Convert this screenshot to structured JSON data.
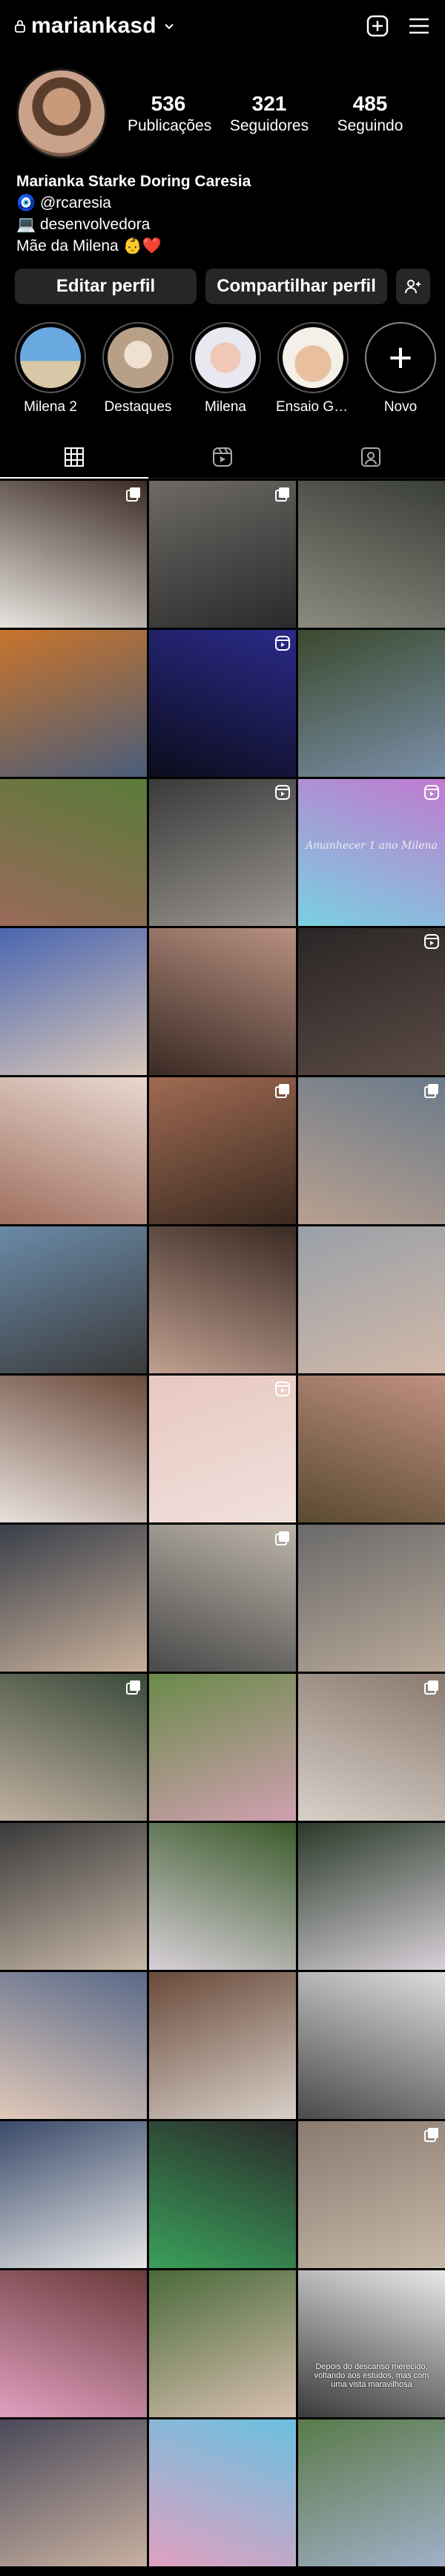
{
  "header": {
    "username": "mariankasd",
    "icons": [
      "lock-icon",
      "chevron-down-icon",
      "create-icon",
      "menu-icon"
    ]
  },
  "stats": [
    {
      "count": "536",
      "label": "Publicações"
    },
    {
      "count": "321",
      "label": "Seguidores"
    },
    {
      "count": "485",
      "label": "Seguindo"
    }
  ],
  "bio": {
    "name": "Marianka Starke Doring Caresia",
    "line1": "🧿 @rcaresia",
    "line2": "💻 desenvolvedora",
    "line3": "Mãe da Milena 👶❤️"
  },
  "actions": {
    "edit": "Editar perfil",
    "share": "Compartilhar perfil"
  },
  "highlights": [
    {
      "label": "Milena 2",
      "color": "#3d7fb8"
    },
    {
      "label": "Destaques",
      "color": "#c8b6a0"
    },
    {
      "label": "Milena",
      "color": "#d8b0a0"
    },
    {
      "label": "Ensaio Gest...",
      "color": "#c9a78e"
    },
    {
      "label": "Novo",
      "color": "#000000"
    }
  ],
  "tabs": [
    "grid-icon",
    "reels-icon",
    "tagged-icon"
  ],
  "posts": [
    {
      "c1": "#3b2b24",
      "c2": "#e8e4df",
      "badge": "multi"
    },
    {
      "c1": "#6d6a66",
      "c2": "#2a2a2a",
      "badge": "multi"
    },
    {
      "c1": "#3a3f37",
      "c2": "#8a8a80",
      "badge": ""
    },
    {
      "c1": "#c8742b",
      "c2": "#4a5d7a",
      "badge": ""
    },
    {
      "c1": "#2a2a8a",
      "c2": "#0c0c1c",
      "badge": "reel"
    },
    {
      "c1": "#3b4a2e",
      "c2": "#7a8fa8",
      "badge": ""
    },
    {
      "c1": "#5a7a3a",
      "c2": "#9a6a5a",
      "badge": ""
    },
    {
      "c1": "#3a3a3a",
      "c2": "#9a9690",
      "badge": "reel"
    },
    {
      "c1": "#c07ad0",
      "c2": "#7ad0e0",
      "badge": "reel",
      "text": "Amanhecer 1 ano Milena"
    },
    {
      "c1": "#4a66b0",
      "c2": "#d8c6b8",
      "badge": ""
    },
    {
      "c1": "#b89080",
      "c2": "#3a2a24",
      "badge": ""
    },
    {
      "c1": "#2a2626",
      "c2": "#5a4a44",
      "badge": "reel"
    },
    {
      "c1": "#e8d8d0",
      "c2": "#a07060",
      "badge": ""
    },
    {
      "c1": "#a06a52",
      "c2": "#3a2a20",
      "badge": "multi"
    },
    {
      "c1": "#6a7a8a",
      "c2": "#b8a090",
      "badge": "multi"
    },
    {
      "c1": "#6a8aa8",
      "c2": "#3a3a3a",
      "badge": ""
    },
    {
      "c1": "#3a2a24",
      "c2": "#c0a090",
      "badge": ""
    },
    {
      "c1": "#9aa0a8",
      "c2": "#d0b8a8",
      "badge": ""
    },
    {
      "c1": "#6a4a3a",
      "c2": "#e8e0dc",
      "badge": ""
    },
    {
      "c1": "#e8c8c0",
      "c2": "#f0e0dc",
      "badge": "reel"
    },
    {
      "c1": "#c09080",
      "c2": "#5a4a30",
      "badge": ""
    },
    {
      "c1": "#3a3f4a",
      "c2": "#c8b09a",
      "badge": ""
    },
    {
      "c1": "#bcb4a8",
      "c2": "#4a4a4a",
      "badge": "multi"
    },
    {
      "c1": "#6a6a6a",
      "c2": "#b8a898",
      "badge": ""
    },
    {
      "c1": "#3a4a3a",
      "c2": "#c0b0a0",
      "badge": "multi"
    },
    {
      "c1": "#6a8a4a",
      "c2": "#d0a0b0",
      "badge": ""
    },
    {
      "c1": "#8a7a70",
      "c2": "#d8d0c8",
      "badge": "multi"
    },
    {
      "c1": "#3a3a3a",
      "c2": "#c8b8a8",
      "badge": ""
    },
    {
      "c1": "#3a5a2a",
      "c2": "#d8d0d8",
      "badge": ""
    },
    {
      "c1": "#2a3a2a",
      "c2": "#d8d0d8",
      "badge": ""
    },
    {
      "c1": "#5a6a8a",
      "c2": "#e0c8b8",
      "badge": ""
    },
    {
      "c1": "#6a4a3a",
      "c2": "#d8d0c8",
      "badge": ""
    },
    {
      "c1": "#dcdcdc",
      "c2": "#4a4a4a",
      "badge": ""
    },
    {
      "c1": "#3a4a6a",
      "c2": "#e8e8e8",
      "badge": ""
    },
    {
      "c1": "#2a2a2a",
      "c2": "#3aa05a",
      "badge": ""
    },
    {
      "c1": "#8a7a70",
      "c2": "#c8b8a8",
      "badge": "multi"
    },
    {
      "c1": "#6a3a3a",
      "c2": "#e0a0c0",
      "badge": ""
    },
    {
      "c1": "#4a6a3a",
      "c2": "#d8c0b0",
      "badge": ""
    },
    {
      "c1": "#e8e8e8",
      "c2": "#3a3a3a",
      "badge": "",
      "text": "Depois do descanso merecido, voltando aos estudos, mas com uma vista maravilhosa"
    },
    {
      "c1": "#4a4a5a",
      "c2": "#c8b0a0",
      "badge": ""
    },
    {
      "c1": "#6ac0e0",
      "c2": "#e0a0c0",
      "badge": ""
    },
    {
      "c1": "#5a7a4a",
      "c2": "#a0b0c8",
      "badge": ""
    }
  ]
}
